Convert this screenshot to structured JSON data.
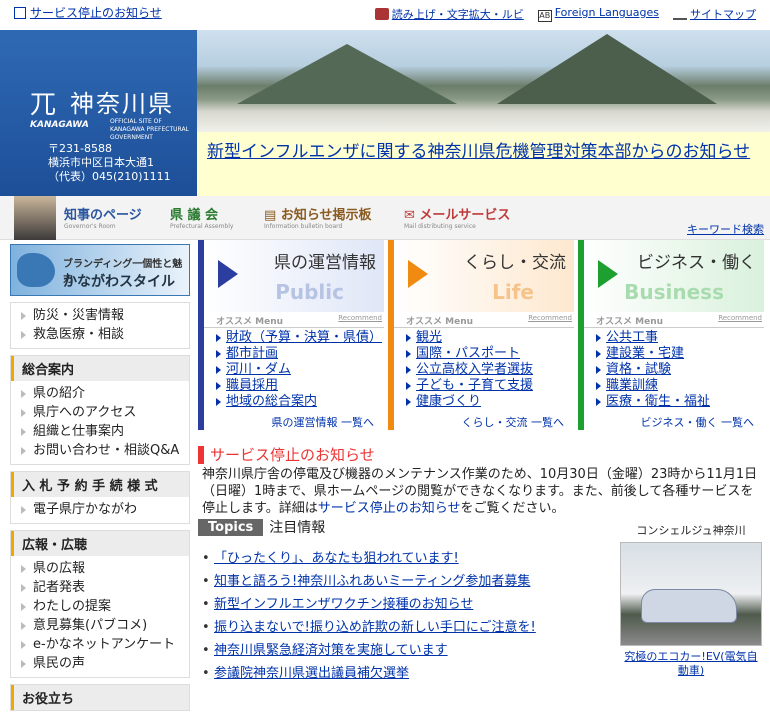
{
  "top": {
    "service_notice": "サービス停止のお知らせ",
    "links": [
      {
        "label": "読み上げ・文字拡大・ルビ",
        "icon": "speaker-icon"
      },
      {
        "label": "Foreign Languages",
        "icon": "ab-icon"
      },
      {
        "label": "サイトマップ",
        "icon": "sitemap-icon"
      }
    ]
  },
  "logo": {
    "mark": "⺎",
    "name": "神奈川県",
    "kana": "KANAGAWA",
    "sub": "OFFICIAL SITE OF KANAGAWA PREFECTURAL GOVERNMENT",
    "zip": "〒231-8588",
    "address": "横浜市中区日本大通1",
    "tel": "（代表）045(210)1111"
  },
  "banner": {
    "text": "新型インフルエンザに関する神奈川県危機管理対策本部からのお知らせ"
  },
  "nav": {
    "items": [
      {
        "label": "知事のページ",
        "sub": "Governor's Room"
      },
      {
        "label": "県 議 会",
        "sub": "Prefectural Assembly"
      },
      {
        "label": "お知らせ掲示板",
        "sub": "Information bulletin board"
      },
      {
        "label": "メールサービス",
        "sub": "Mail distributing service"
      }
    ],
    "keyword": "キーワード検索"
  },
  "sidebar": {
    "brand_line1": "ブランディング一個性と魅力",
    "brand_line2": "かながわスタイル",
    "box1": [
      "防災・災害情報",
      "救急医療・相談"
    ],
    "box2_title": "総合案内",
    "box2": [
      "県の紹介",
      "県庁へのアクセス",
      "組織と仕事案内",
      "お問い合わせ・相談Q&A"
    ],
    "box3_title": "入 札 予 約 手 続 様 式",
    "box3": [
      "電子県庁かながわ"
    ],
    "box4_title": "広報・広聴",
    "box4": [
      "県の広報",
      "記者発表",
      "わたしの提案",
      "意見募集(パブコメ)",
      "e-かなネットアンケート",
      "県民の声"
    ],
    "box5_title": "お役立ち"
  },
  "categories": [
    {
      "title": "県の運営情報",
      "eng": "Public",
      "menu": "オススメ Menu",
      "rec": "Recommend",
      "items": [
        "財政（予算・決算・県債）",
        "都市計画",
        "河川・ダム",
        "職員採用",
        "地域の総合案内"
      ],
      "more": "県の運営情報 一覧へ"
    },
    {
      "title": "くらし・交流",
      "eng": "Life",
      "menu": "オススメ Menu",
      "rec": "Recommend",
      "items": [
        "観光",
        "国際・パスポート",
        "公立高校入学者選抜",
        "子ども・子育て支援",
        "健康づくり"
      ],
      "more": "くらし・交流 一覧へ"
    },
    {
      "title": "ビジネス・働く",
      "eng": "Business",
      "menu": "オススメ Menu",
      "rec": "Recommend",
      "items": [
        "公共工事",
        "建設業・宅建",
        "資格・試験",
        "職業訓練",
        "医療・衛生・福祉"
      ],
      "more": "ビジネス・働く 一覧へ"
    }
  ],
  "notice": {
    "title": "サービス停止のお知らせ",
    "body1": "神奈川県庁舎の停電及び機器のメンテナンス作業のため、10月30日（金曜）23時から11月1日（日曜）1時まで、県ホームページの閲覧ができなくなります。また、前後して各種サービスを停止します。詳細は",
    "link": "サービス停止のお知らせ",
    "body2": "をご覧ください。"
  },
  "topics": {
    "tag": "Topics",
    "title": "注目情報",
    "items": [
      "「ひったくり」、あなたも狙われています!",
      "知事と語ろう!神奈川ふれあいミーティング参加者募集",
      "新型インフルエンザワクチン接種のお知らせ",
      "振り込まないで!振り込め詐欺の新しい手口にご注意を!",
      "神奈川県緊急経済対策を実施しています",
      "参議院神奈川県選出議員補欠選挙"
    ]
  },
  "concierge": {
    "title": "コンシェルジュ神奈川",
    "caption": "究極のエコカー!EV(電気自動車)"
  },
  "colors": {
    "blue_cat": "#2b3ea0",
    "orange_cat": "#f08a10",
    "green_cat": "#1ea030",
    "link": "#0033aa",
    "notice_red": "#ee3333"
  }
}
